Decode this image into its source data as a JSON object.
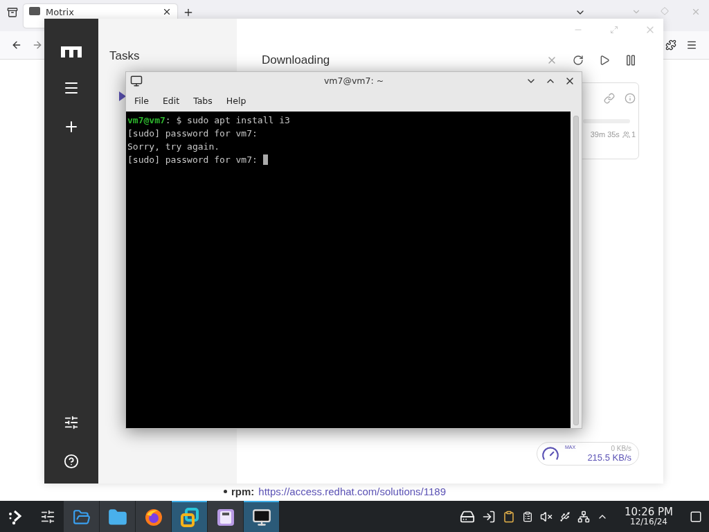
{
  "browser": {
    "tabs": [
      {
        "label": "Motrix",
        "selected": true
      }
    ],
    "page": {
      "bullet_label": "rpm:",
      "link": "https://access.redhat.com/solutions/1189"
    }
  },
  "motrix": {
    "sidebar_title": "Tasks",
    "header_title": "Downloading",
    "task_card": {
      "time_remaining": "39m 35s",
      "connections": "1"
    },
    "speed": {
      "limit_label": "MAX",
      "upload": "0 KB/s",
      "download": "215.5 KB/s"
    }
  },
  "terminal": {
    "title": "vm7@vm7: ~",
    "menu": [
      "File",
      "Edit",
      "Tabs",
      "Help"
    ],
    "lines": [
      {
        "kind": "command",
        "prompt": "vm7@vm7",
        "text": ": $ sudo apt install i3"
      },
      {
        "kind": "output",
        "text": "[sudo] password for vm7:"
      },
      {
        "kind": "output",
        "text": "Sorry, try again."
      },
      {
        "kind": "input",
        "text": "[sudo] password for vm7: "
      }
    ]
  },
  "taskbar": {
    "apps": [
      {
        "kind": "files-blue",
        "selected": false
      },
      {
        "kind": "folder",
        "selected": false
      },
      {
        "kind": "firefox",
        "selected": false
      },
      {
        "kind": "vm",
        "selected": true
      },
      {
        "kind": "disk",
        "selected": false
      },
      {
        "kind": "monitor",
        "selected": true
      }
    ],
    "clock": {
      "time": "10:26 PM",
      "date": "12/16/24"
    }
  }
}
